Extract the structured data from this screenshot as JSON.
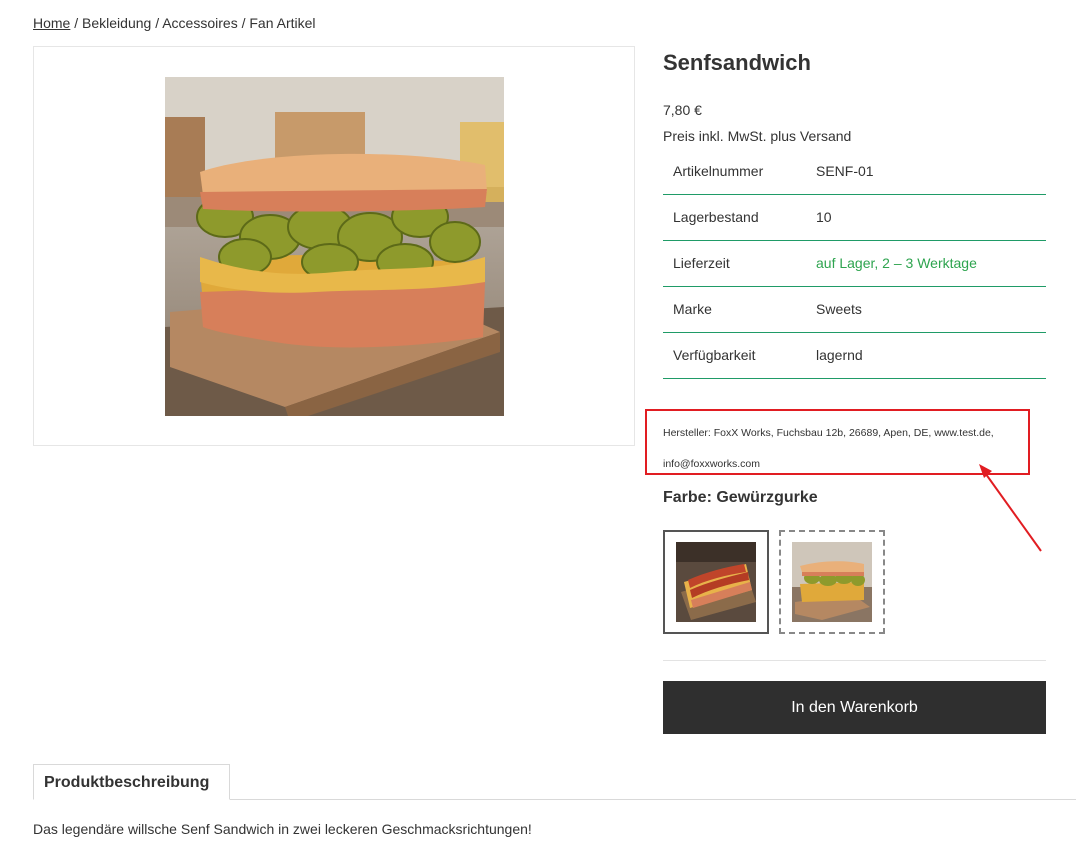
{
  "breadcrumb": {
    "home": "Home",
    "sep1": "/",
    "cat1": "Bekleidung",
    "sep2": "/",
    "cat2": "Accessoires",
    "sep3": "/",
    "cat3": "Fan Artikel"
  },
  "product": {
    "title": "Senfsandwich",
    "price": "7,80 €",
    "tax_note": "Preis inkl. MwSt. plus Versand"
  },
  "properties": [
    {
      "key": "Artikelnummer",
      "value": "SENF-01"
    },
    {
      "key": "Lagerbestand",
      "value": "10"
    },
    {
      "key": "Lieferzeit",
      "value": "auf Lager, 2 – 3 Werktage"
    },
    {
      "key": "Marke",
      "value": "Sweets"
    },
    {
      "key": "Verfügbarkeit",
      "value": "lagernd"
    }
  ],
  "manufacturer": "Hersteller: FoxX Works, Fuchsbau 12b, 26689, Apen, DE, www.test.de, info@foxxworks.com",
  "variant": {
    "label": "Farbe: Gewürzgurke",
    "options": [
      "hotdog-sandwich-thumbnail",
      "pickle-sandwich-thumbnail"
    ]
  },
  "cart_button": "In den Warenkorb",
  "tabs": {
    "description_tab": "Produktbeschreibung",
    "description_text": "Das legendäre willsche Senf Sandwich in zwei leckeren Geschmacksrichtungen!"
  },
  "colors": {
    "accent_green": "#2ea44f",
    "table_border": "#1f9b67",
    "highlight_red": "#e11d22",
    "button_dark": "#2f2f2f"
  }
}
